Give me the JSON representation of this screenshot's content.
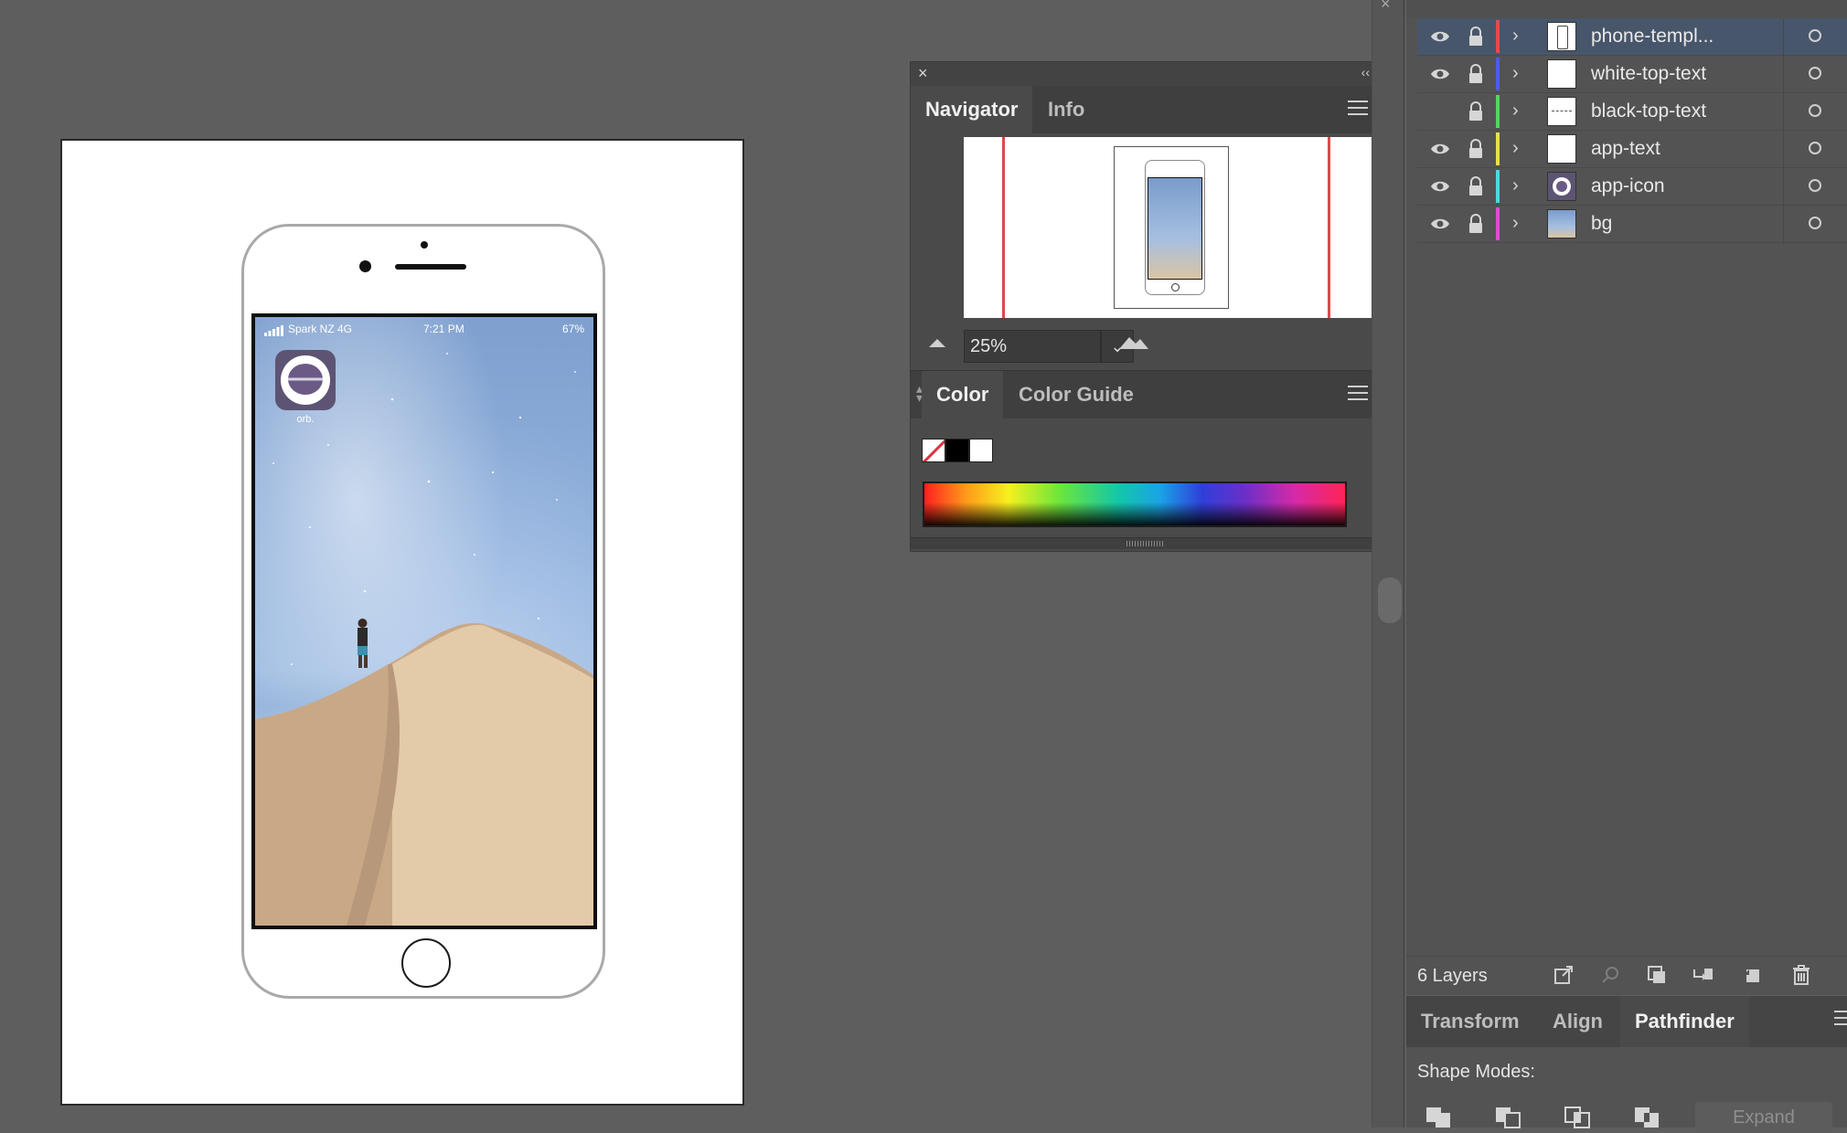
{
  "phone": {
    "status": {
      "carrier": "Spark NZ  4G",
      "time": "7:21 PM",
      "battery": "67%"
    },
    "app": {
      "label": "orb."
    }
  },
  "navigator_panel": {
    "tabs": [
      "Navigator",
      "Info"
    ],
    "active_tab": "Navigator",
    "zoom": "25%",
    "close_glyph": "×",
    "collapse_glyph": "‹‹"
  },
  "color_panel": {
    "tabs": [
      "Color",
      "Color Guide"
    ],
    "active_tab": "Color"
  },
  "layers_panel": {
    "layers": [
      {
        "name": "phone-templ...",
        "visible": true,
        "color": "#e34b4b",
        "selected": true
      },
      {
        "name": "white-top-text",
        "visible": true,
        "color": "#4b5ee3",
        "selected": false
      },
      {
        "name": "black-top-text",
        "visible": false,
        "color": "#57d35c",
        "selected": false
      },
      {
        "name": "app-text",
        "visible": true,
        "color": "#e7df4f",
        "selected": false
      },
      {
        "name": "app-icon",
        "visible": true,
        "color": "#4fd6df",
        "selected": false
      },
      {
        "name": "bg",
        "visible": true,
        "color": "#d84fd6",
        "selected": false
      }
    ],
    "count_label": "6 Layers"
  },
  "properties_panel": {
    "tabs": [
      "Transform",
      "Align",
      "Pathfinder"
    ],
    "active_tab": "Pathfinder",
    "shape_modes_label": "Shape Modes:",
    "expand_label": "Expand"
  }
}
